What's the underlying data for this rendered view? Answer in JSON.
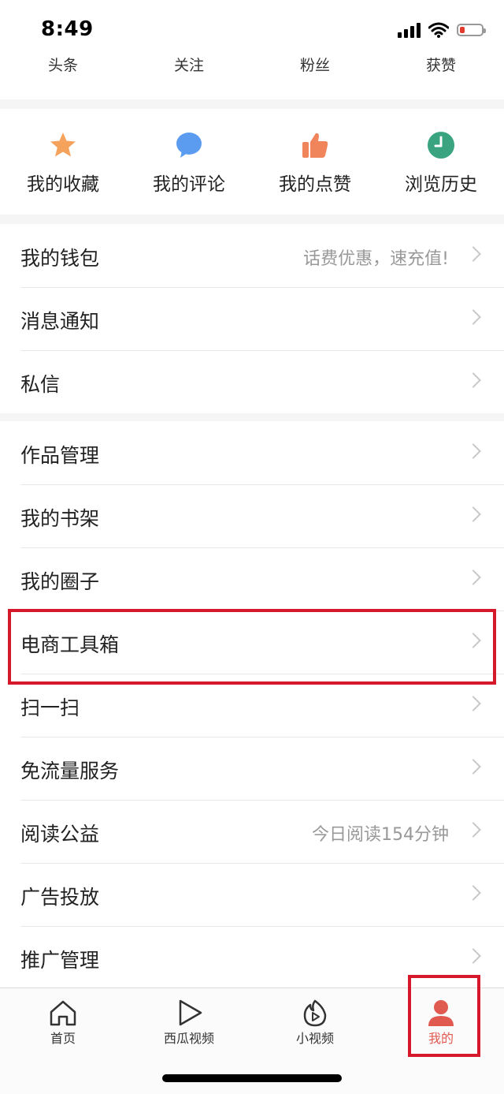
{
  "status": {
    "time": "8:49"
  },
  "stats": [
    {
      "label": "头条"
    },
    {
      "label": "关注"
    },
    {
      "label": "粉丝"
    },
    {
      "label": "获赞"
    }
  ],
  "quick": [
    {
      "label": "我的收藏",
      "icon": "star-icon",
      "color": "#f5a25d"
    },
    {
      "label": "我的评论",
      "icon": "comment-icon",
      "color": "#5b9cf0"
    },
    {
      "label": "我的点赞",
      "icon": "thumbs-up-icon",
      "color": "#f0845a"
    },
    {
      "label": "浏览历史",
      "icon": "clock-icon",
      "color": "#3aa37f"
    }
  ],
  "groups": [
    {
      "items": [
        {
          "label": "我的钱包",
          "hint": "话费优惠，速充值!"
        },
        {
          "label": "消息通知",
          "hint": ""
        },
        {
          "label": "私信",
          "hint": ""
        }
      ]
    },
    {
      "items": [
        {
          "label": "作品管理",
          "hint": ""
        },
        {
          "label": "我的书架",
          "hint": ""
        },
        {
          "label": "我的圈子",
          "hint": ""
        },
        {
          "label": "电商工具箱",
          "hint": ""
        },
        {
          "label": "扫一扫",
          "hint": ""
        },
        {
          "label": "免流量服务",
          "hint": ""
        },
        {
          "label": "阅读公益",
          "hint": "今日阅读154分钟"
        },
        {
          "label": "广告投放",
          "hint": ""
        },
        {
          "label": "推广管理",
          "hint": ""
        }
      ]
    }
  ],
  "tabbar": [
    {
      "label": "首页",
      "icon": "home-icon"
    },
    {
      "label": "西瓜视频",
      "icon": "play-icon"
    },
    {
      "label": "小视频",
      "icon": "flame-play-icon"
    },
    {
      "label": "我的",
      "icon": "user-icon",
      "active": true
    }
  ],
  "colors": {
    "accent": "#e05a50",
    "highlight": "#d5182a"
  }
}
